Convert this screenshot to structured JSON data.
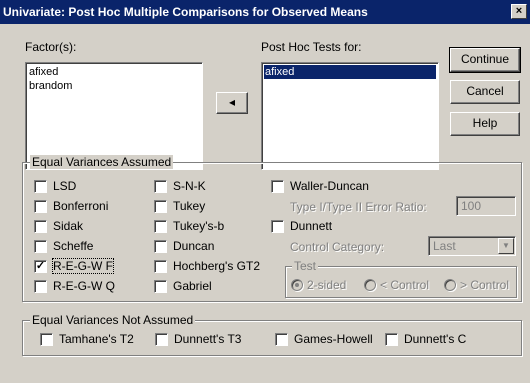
{
  "window": {
    "title": "Univariate: Post Hoc Multiple Comparisons for Observed Means",
    "close_glyph": "×"
  },
  "factors": {
    "label": "Factor(s):",
    "items": [
      "afixed",
      "brandom"
    ]
  },
  "move_button": {
    "glyph": "◂"
  },
  "post_hoc": {
    "label": "Post Hoc Tests for:",
    "items": [
      "afixed"
    ]
  },
  "buttons": {
    "continue": "Continue",
    "cancel": "Cancel",
    "help": "Help"
  },
  "equal_variances": {
    "label": "Equal Variances Assumed",
    "col1": [
      {
        "label": "LSD",
        "checked": false
      },
      {
        "label": "Bonferroni",
        "checked": false
      },
      {
        "label": "Sidak",
        "checked": false
      },
      {
        "label": "Scheffe",
        "checked": false
      },
      {
        "label": "R-E-G-W F",
        "checked": true
      },
      {
        "label": "R-E-G-W Q",
        "checked": false
      }
    ],
    "col2": [
      {
        "label": "S-N-K",
        "checked": false
      },
      {
        "label": "Tukey",
        "checked": false
      },
      {
        "label": "Tukey's-b",
        "checked": false
      },
      {
        "label": "Duncan",
        "checked": false
      },
      {
        "label": "Hochberg's GT2",
        "checked": false
      },
      {
        "label": "Gabriel",
        "checked": false
      }
    ],
    "waller_duncan": "Waller-Duncan",
    "error_ratio_label": "Type I/Type II Error Ratio:",
    "error_ratio_value": "100",
    "dunnett": "Dunnett",
    "control_category_label": "Control Category:",
    "control_category_value": "Last",
    "test_label": "Test",
    "test_options": [
      "2-sided",
      "< Control",
      "> Control"
    ],
    "test_selected": "2-sided"
  },
  "not_assumed": {
    "label": "Equal Variances Not Assumed",
    "items": [
      {
        "label": "Tamhane's T2",
        "checked": false
      },
      {
        "label": "Dunnett's T3",
        "checked": false
      },
      {
        "label": "Games-Howell",
        "checked": false
      },
      {
        "label": "Dunnett's C",
        "checked": false
      }
    ]
  }
}
